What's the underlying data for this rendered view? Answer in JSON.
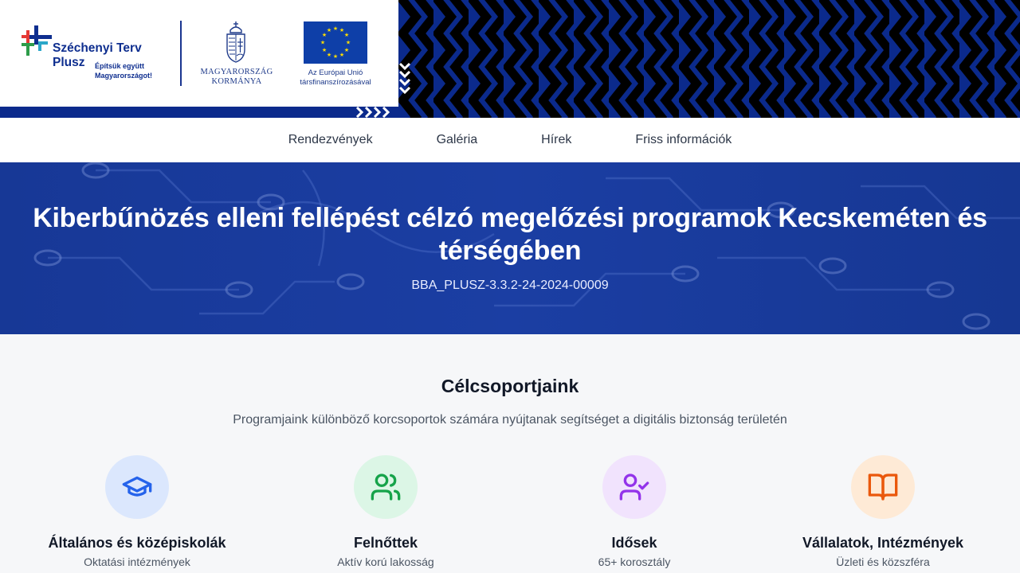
{
  "header": {
    "program_name_line1": "Széchenyi Terv",
    "program_name_line2": "Plusz",
    "program_tagline": "Építsük együtt Magyarországot!",
    "government_text": "MAGYARORSZÁG KORMÁNYA",
    "eu_text": "Az Európai Unió társfinanszírozásával",
    "icons": [
      "szechenyi-plus-logo-icon",
      "hungarian-coat-of-arms-icon",
      "eu-flag-icon"
    ]
  },
  "nav": {
    "items": [
      {
        "label": "Rendezvények"
      },
      {
        "label": "Galéria"
      },
      {
        "label": "Hírek"
      },
      {
        "label": "Friss információk"
      }
    ]
  },
  "hero": {
    "title": "Kiberbűnözés elleni fellépést célzó megelőzési programok Kecskeméten és térségében",
    "project_code": "BBA_PLUSZ-3.3.2-24-2024-00009"
  },
  "target_groups": {
    "title": "Célcsoportjaink",
    "subtitle": "Programjaink különböző korcsoportok számára nyújtanak segítséget a digitális biztonság területén",
    "cards": [
      {
        "title": "Általános és középiskolák",
        "subtitle": "Oktatási intézmények",
        "icon": "graduation-cap-icon",
        "color": "#2563eb",
        "bg": "#dbe7fd"
      },
      {
        "title": "Felnőttek",
        "subtitle": "Aktív korú lakosság",
        "icon": "users-icon",
        "color": "#16a34a",
        "bg": "#dcf6e6"
      },
      {
        "title": "Idősek",
        "subtitle": "65+ korosztály",
        "icon": "user-check-icon",
        "color": "#9333ea",
        "bg": "#f1e3fd"
      },
      {
        "title": "Vállalatok, Intézmények",
        "subtitle": "Üzleti és közszféra",
        "icon": "book-open-icon",
        "color": "#ea580c",
        "bg": "#feead6"
      }
    ]
  },
  "colors": {
    "brand_blue": "#0b2a8c",
    "hero_blue": "#1b3ea3",
    "page_bg": "#f6f7f9"
  }
}
